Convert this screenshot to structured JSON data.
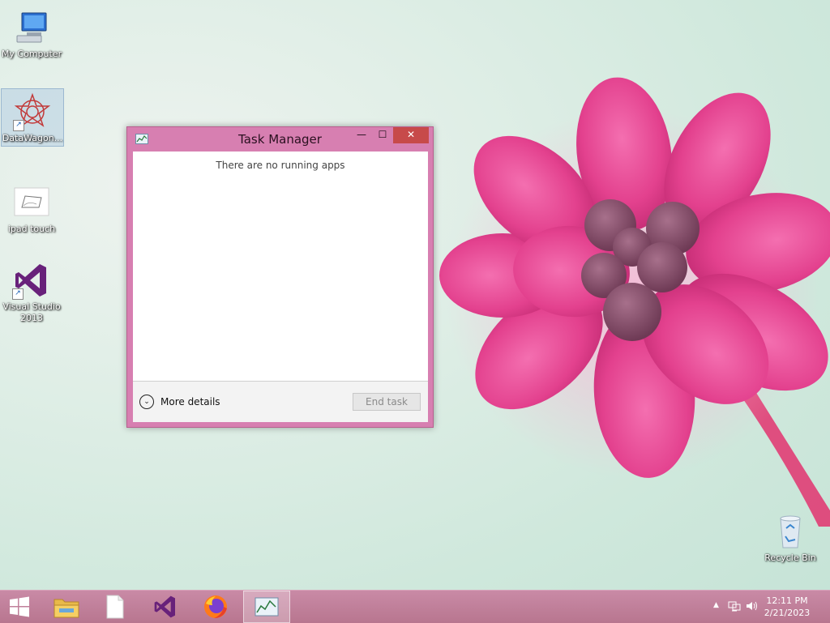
{
  "desktop": {
    "icons": [
      {
        "label": "My Computer",
        "icon": "computer-icon"
      },
      {
        "label": "DataWagon...",
        "icon": "datawagon-icon"
      },
      {
        "label": "ipad touch",
        "icon": "drawing-file-icon"
      },
      {
        "label": "Visual Studio 2013",
        "icon": "visual-studio-icon"
      },
      {
        "label": "Recycle Bin",
        "icon": "recycle-bin-icon"
      }
    ]
  },
  "task_manager": {
    "title": "Task Manager",
    "minimize_glyph": "—",
    "maximize_glyph": "☐",
    "close_glyph": "✕",
    "empty_message": "There are no running apps",
    "more_details_label": "More details",
    "end_task_label": "End task"
  },
  "taskbar": {
    "items": [
      {
        "icon": "start-windows-icon"
      },
      {
        "icon": "file-explorer-icon"
      },
      {
        "icon": "blank-document-icon"
      },
      {
        "icon": "visual-studio-icon"
      },
      {
        "icon": "firefox-icon"
      },
      {
        "icon": "task-manager-icon"
      }
    ],
    "tray": {
      "time": "12:11 PM",
      "date": "2/21/2023"
    }
  },
  "colors": {
    "window_frame": "#d77fb1",
    "close_button": "#c74a4a",
    "taskbar": "#c98aa6"
  }
}
